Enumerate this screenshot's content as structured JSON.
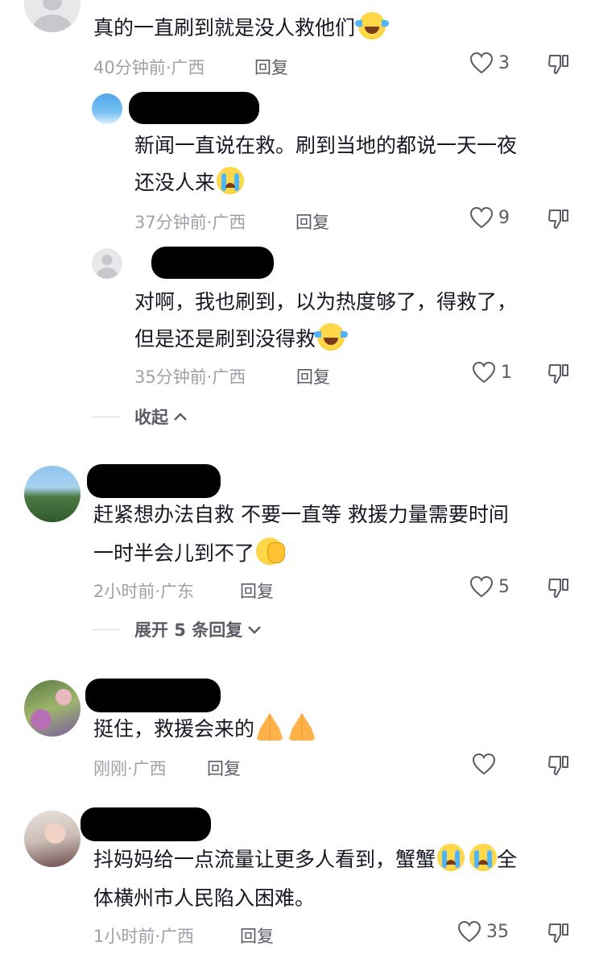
{
  "comments": [
    {
      "text_lines": [
        "真的一直刷到就是没人救他们"
      ],
      "time": "40分钟前",
      "location": "广西",
      "reply_label": "回复",
      "likes": "3",
      "replies": [
        {
          "text_lines": [
            "新闻一直说在救。刷到当地的都说一天一夜",
            "还没人来"
          ],
          "time": "37分钟前",
          "location": "广西",
          "reply_label": "回复",
          "likes": "9"
        },
        {
          "text_lines": [
            "对啊，我也刷到，以为热度够了，得救了，",
            "但是还是刷到没得救"
          ],
          "time": "35分钟前",
          "location": "广西",
          "reply_label": "回复",
          "likes": "1"
        }
      ],
      "collapse_label": "收起"
    },
    {
      "text_lines": [
        "赶紧想办法自救  不要一直等  救援力量需要时间",
        "一时半会儿到不了"
      ],
      "time": "2小时前",
      "location": "广东",
      "reply_label": "回复",
      "likes": "5",
      "expand_label": "展开 5 条回复"
    },
    {
      "text_lines": [
        "挺住，救援会来的"
      ],
      "time": "刚刚",
      "location": "广西",
      "reply_label": "回复",
      "likes": ""
    },
    {
      "text_lines": [
        "抖妈妈给一点流量让更多人看到，蟹蟹",
        "体横州市人民陷入困难。"
      ],
      "text_tail": "全",
      "time": "1小时前",
      "location": "广西",
      "reply_label": "回复",
      "likes": "35"
    }
  ],
  "meta_separator": "·",
  "icons": {
    "like": "heart-outline-icon",
    "dislike": "thumbs-down-icon",
    "collapse": "chevron-up-icon",
    "expand": "chevron-down-icon"
  },
  "colors": {
    "text": "#161823",
    "meta": "#a0a0a8",
    "action": "#5b5b66"
  }
}
